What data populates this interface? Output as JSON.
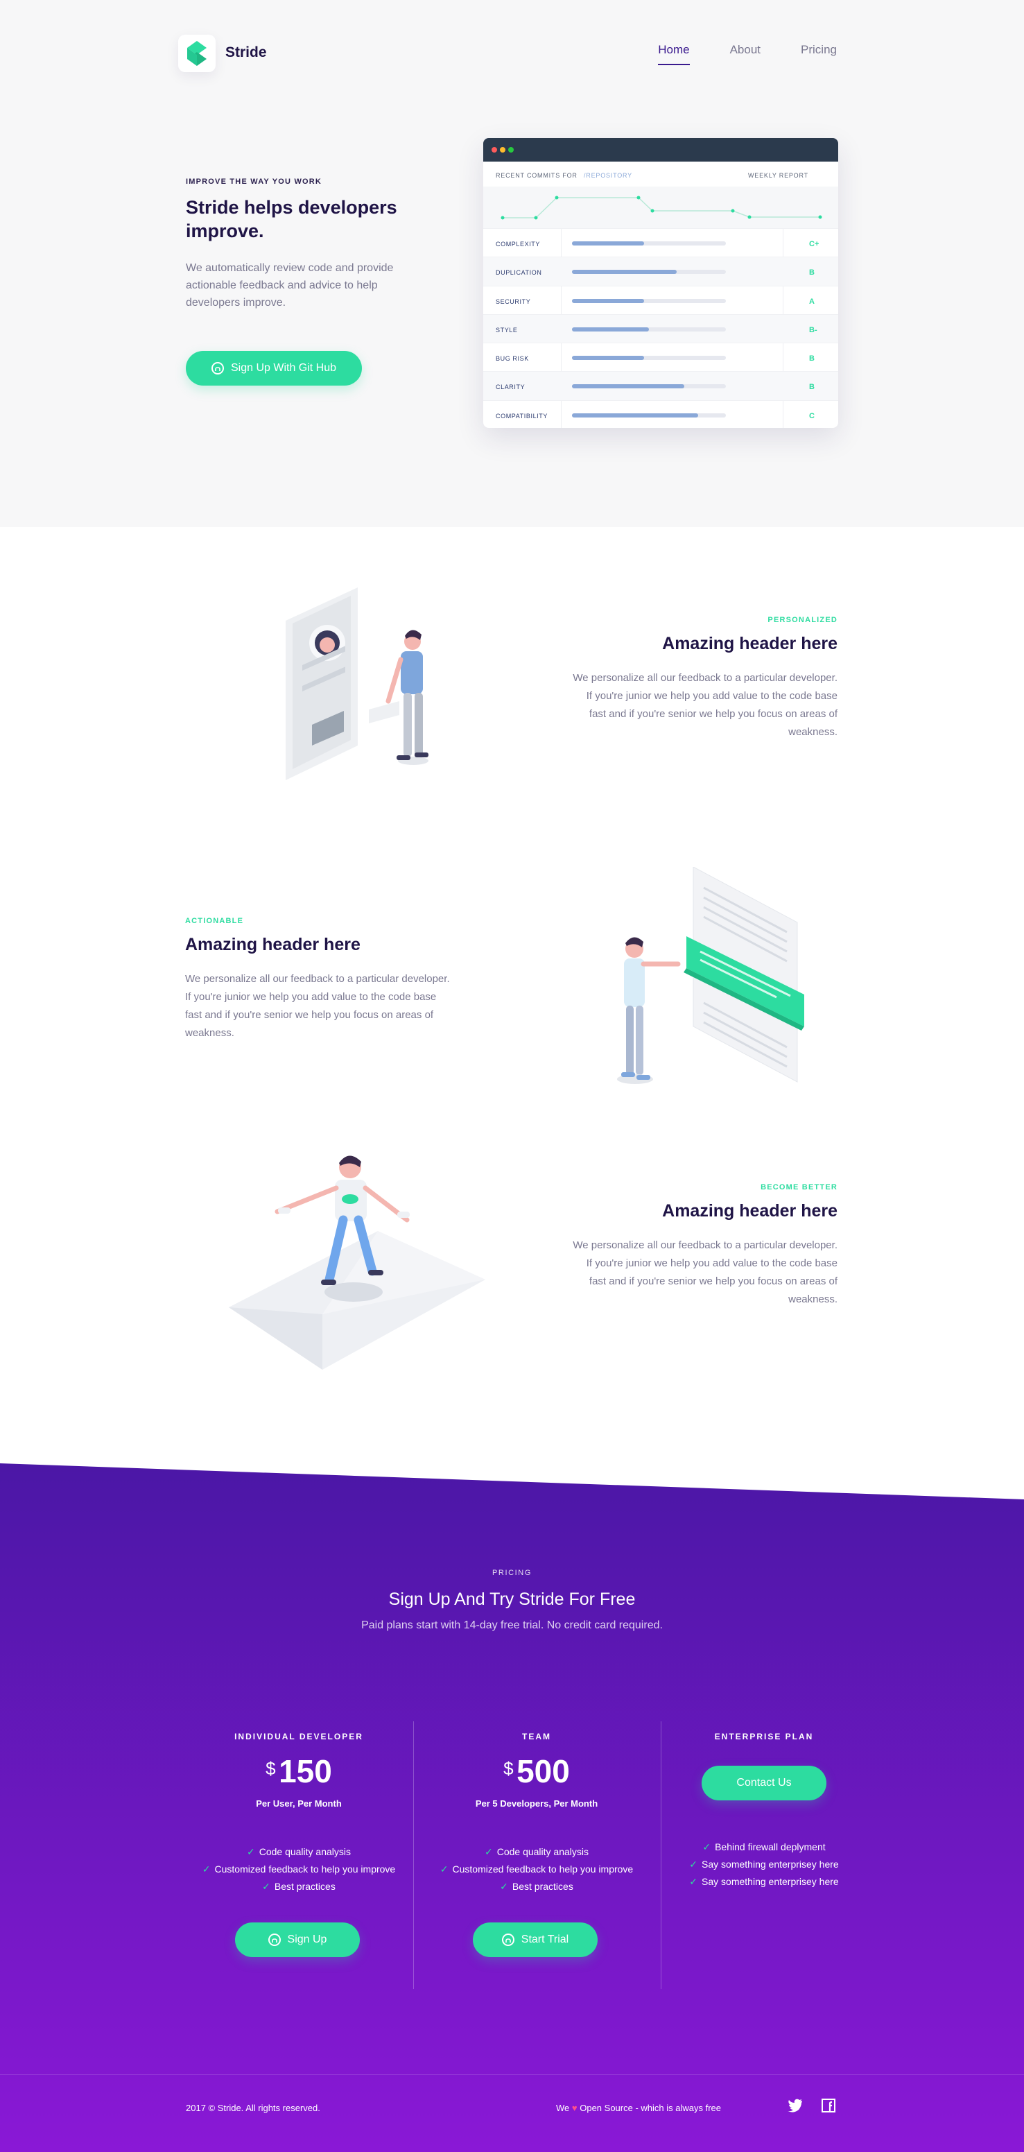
{
  "brand": {
    "name": "Stride"
  },
  "nav": {
    "items": [
      {
        "label": "Home"
      },
      {
        "label": "About"
      },
      {
        "label": "Pricing"
      }
    ]
  },
  "hero": {
    "eyebrow": "IMPROVE THE WAY YOU WORK",
    "title": "Stride helps developers improve.",
    "description": "We automatically review code and provide actionable feedback and advice to help developers improve.",
    "cta_label": "Sign Up With Git Hub"
  },
  "report": {
    "commits_label": "RECENT COMMITS FOR",
    "repo_label": "/REPOSITORY",
    "weekly_label": "WEEKLY REPORT",
    "rows": [
      {
        "label": "COMPLEXITY",
        "progress": 0.47,
        "grade": "C+"
      },
      {
        "label": "DUPLICATION",
        "progress": 0.68,
        "grade": "B"
      },
      {
        "label": "SECURITY",
        "progress": 0.47,
        "grade": "A"
      },
      {
        "label": "STYLE",
        "progress": 0.5,
        "grade": "B-"
      },
      {
        "label": "BUG RISK",
        "progress": 0.47,
        "grade": "B"
      },
      {
        "label": "CLARITY",
        "progress": 0.73,
        "grade": "B"
      },
      {
        "label": "COMPATIBILITY",
        "progress": 0.82,
        "grade": "C"
      }
    ],
    "colors": {
      "bar": "#8aa8d8",
      "grade": "#2ddca0",
      "window_bar": "#2b3a4d"
    }
  },
  "features": [
    {
      "eyebrow": "PERSONALIZED",
      "title": "Amazing header here",
      "description": "We personalize all our feedback to a particular developer. If you're junior we help you add value to the code base fast and if you're senior we help you focus on areas of weakness."
    },
    {
      "eyebrow": "ACTIONABLE",
      "title": "Amazing header here",
      "description": "We personalize all our feedback to a particular developer. If you're junior we help you add value to the code base fast and if you're senior we help you focus on areas of weakness."
    },
    {
      "eyebrow": "BECOME BETTER",
      "title": "Amazing header here",
      "description": "We personalize all our feedback to a particular developer. If you're junior we help you add value to the code base fast and if you're senior we help you focus on areas of weakness."
    }
  ],
  "pricing": {
    "eyebrow": "PRICING",
    "title": "Sign Up And Try Stride For Free",
    "subtitle": "Paid plans start with 14-day free trial. No credit card required.",
    "plans": [
      {
        "name": "INDIVIDUAL DEVELOPER",
        "currency": "$",
        "price": "150",
        "per": "Per User, Per Month",
        "features": [
          "Code quality analysis",
          "Customized feedback to help you improve",
          "Best practices"
        ],
        "cta": "Sign Up"
      },
      {
        "name": "TEAM",
        "currency": "$",
        "price": "500",
        "per": "Per 5 Developers, Per Month",
        "features": [
          "Code quality analysis",
          "Customized feedback to help you improve",
          "Best practices"
        ],
        "cta": "Start Trial"
      },
      {
        "name": "ENTERPRISE PLAN",
        "cta": "Contact Us",
        "features": [
          "Behind firewall deplyment",
          "Say something enterprisey here",
          "Say something enterprisey here"
        ]
      }
    ]
  },
  "footer": {
    "copyright": "2017 © Stride. All rights reserved.",
    "note_prefix": "We",
    "note_heart": "♥",
    "note_suffix": "Open Source - which is always free"
  },
  "theme": {
    "accent": "#2ddca0",
    "purple_top": "#4b17a6",
    "purple_bottom": "#8a18d6",
    "heading": "#1f1446"
  }
}
